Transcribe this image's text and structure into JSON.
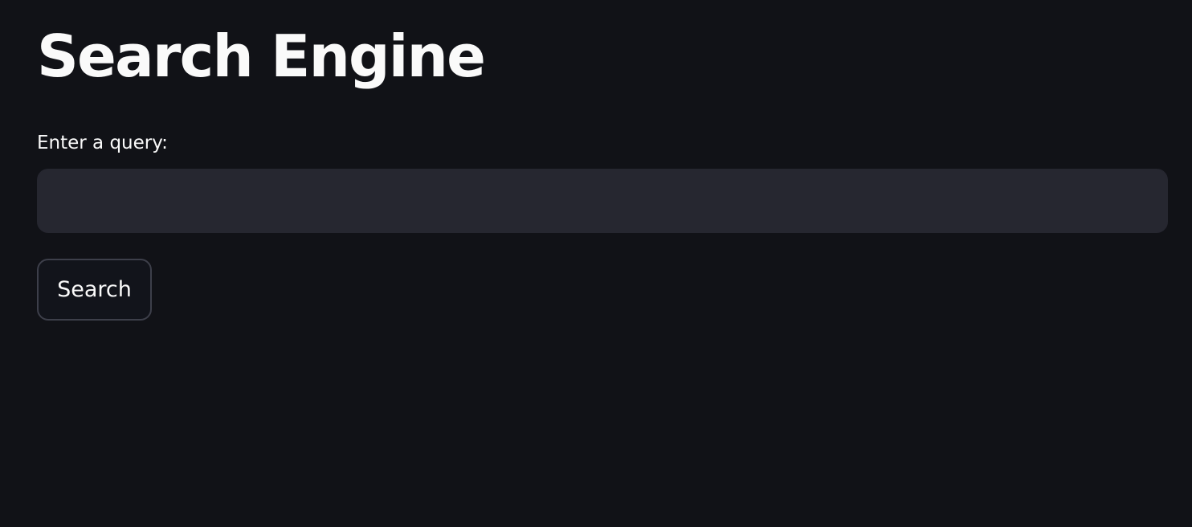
{
  "page": {
    "title": "Search Engine"
  },
  "query_field": {
    "label": "Enter a query:",
    "value": "",
    "placeholder": ""
  },
  "search_button": {
    "label": "Search"
  },
  "colors": {
    "background": "#111217",
    "input_background": "#262730",
    "button_background": "#12141b",
    "button_border": "#3d3f4a",
    "text": "#fafafa"
  }
}
